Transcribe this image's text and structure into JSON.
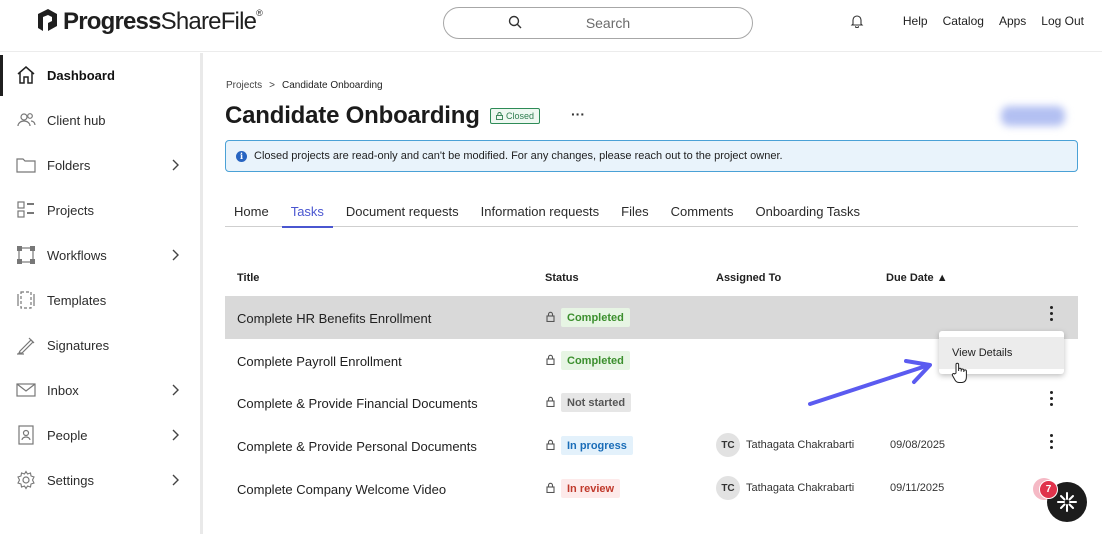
{
  "header": {
    "brand_bold": "Progress",
    "brand_light": "ShareFile",
    "brand_mark": "®",
    "search_placeholder": "Search",
    "nav": [
      "Help",
      "Catalog",
      "Apps",
      "Log Out"
    ]
  },
  "sidebar": {
    "items": [
      {
        "label": "Dashboard",
        "icon": "home-icon",
        "active": true,
        "chevron": false
      },
      {
        "label": "Client hub",
        "icon": "people-icon",
        "active": false,
        "chevron": false
      },
      {
        "label": "Folders",
        "icon": "folder-icon",
        "active": false,
        "chevron": true
      },
      {
        "label": "Projects",
        "icon": "projects-icon",
        "active": false,
        "chevron": false
      },
      {
        "label": "Workflows",
        "icon": "workflow-icon",
        "active": false,
        "chevron": true
      },
      {
        "label": "Templates",
        "icon": "template-icon",
        "active": false,
        "chevron": false
      },
      {
        "label": "Signatures",
        "icon": "pen-icon",
        "active": false,
        "chevron": false
      },
      {
        "label": "Inbox",
        "icon": "mail-icon",
        "active": false,
        "chevron": true
      },
      {
        "label": "People",
        "icon": "contact-card-icon",
        "active": false,
        "chevron": true
      },
      {
        "label": "Settings",
        "icon": "gear-icon",
        "active": false,
        "chevron": true
      }
    ]
  },
  "breadcrumb": {
    "parent": "Projects",
    "separator": ">",
    "current": "Candidate Onboarding"
  },
  "page": {
    "title": "Candidate Onboarding",
    "badge": "Closed",
    "more": "···",
    "banner": "Closed projects are read-only and can't be modified. For any changes, please reach out to the project owner."
  },
  "tabs": [
    {
      "label": "Home",
      "active": false
    },
    {
      "label": "Tasks",
      "active": true
    },
    {
      "label": "Document requests",
      "active": false
    },
    {
      "label": "Information requests",
      "active": false
    },
    {
      "label": "Files",
      "active": false
    },
    {
      "label": "Comments",
      "active": false
    },
    {
      "label": "Onboarding Tasks",
      "active": false
    }
  ],
  "table": {
    "headers": {
      "title": "Title",
      "status": "Status",
      "assigned": "Assigned To",
      "due": "Due Date ▲"
    },
    "rows": [
      {
        "title": "Complete HR Benefits Enrollment",
        "status": "Completed",
        "initials": "",
        "assignee": "",
        "due": ""
      },
      {
        "title": "Complete Payroll Enrollment",
        "status": "Completed",
        "initials": "",
        "assignee": "",
        "due": ""
      },
      {
        "title": "Complete & Provide Financial Documents",
        "status": "Not started",
        "initials": "",
        "assignee": "",
        "due": ""
      },
      {
        "title": "Complete & Provide Personal Documents",
        "status": "In progress",
        "initials": "TC",
        "assignee": "Tathagata Chakrabarti",
        "due": "09/08/2025"
      },
      {
        "title": "Complete Company Welcome Video",
        "status": "In review",
        "initials": "TC",
        "assignee": "Tathagata Chakrabarti",
        "due": "09/11/2025"
      }
    ]
  },
  "context_menu": {
    "item": "View Details"
  },
  "chat": {
    "badge_count": "7"
  },
  "colors": {
    "accent": "#4a56d0",
    "arrow": "#5b5bf0",
    "banner_border": "#4aa1d6"
  }
}
